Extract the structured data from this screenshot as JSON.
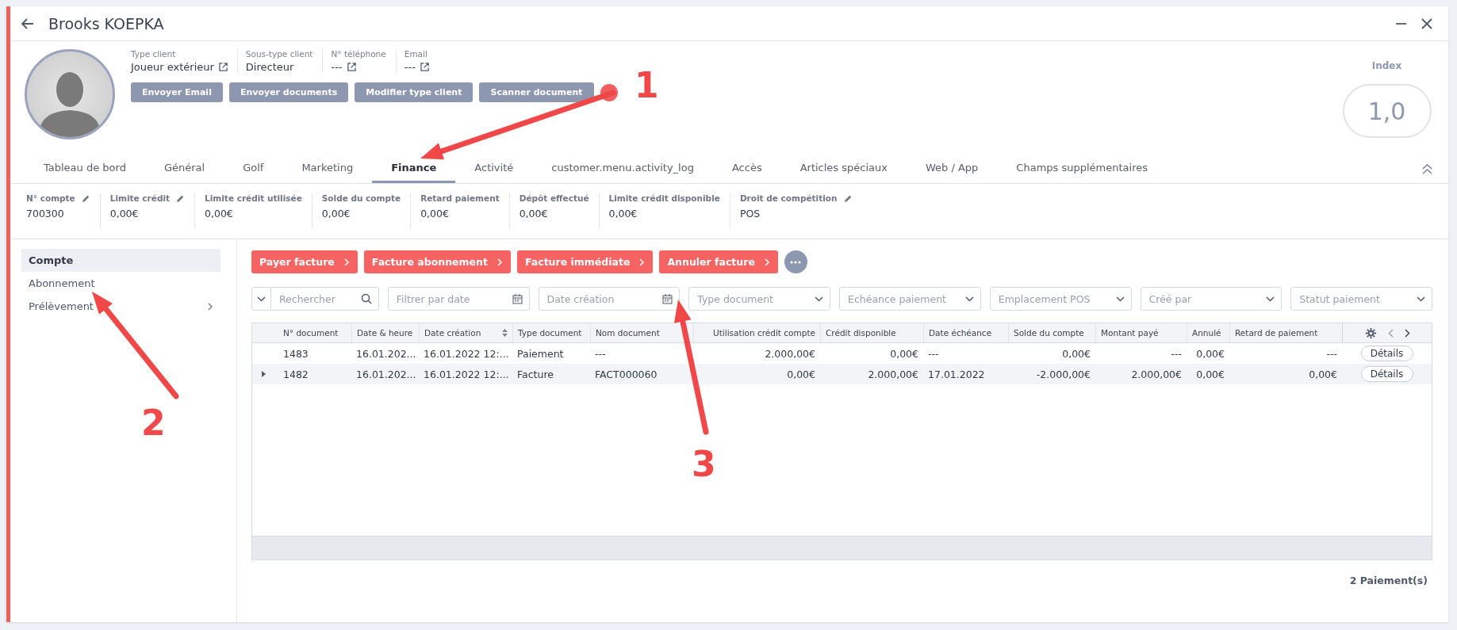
{
  "window": {
    "title": "Brooks KOEPKA"
  },
  "profile": {
    "fields": [
      {
        "label": "Type client",
        "value": "Joueur extérieur",
        "link": true
      },
      {
        "label": "Sous-type client",
        "value": "Directeur",
        "link": false
      },
      {
        "label": "N° téléphone",
        "value": "---",
        "link": true
      },
      {
        "label": "Email",
        "value": "---",
        "link": true
      }
    ],
    "buttons": [
      "Envoyer Email",
      "Envoyer documents",
      "Modifier type client",
      "Scanner document"
    ],
    "index": {
      "label": "Index",
      "value": "1,0"
    }
  },
  "tabs": [
    {
      "label": "Tableau de bord",
      "selected": false
    },
    {
      "label": "Général",
      "selected": false
    },
    {
      "label": "Golf",
      "selected": false
    },
    {
      "label": "Marketing",
      "selected": false
    },
    {
      "label": "Finance",
      "selected": true
    },
    {
      "label": "Activité",
      "selected": false
    },
    {
      "label": "customer.menu.activity_log",
      "selected": false
    },
    {
      "label": "Accès",
      "selected": false
    },
    {
      "label": "Articles spéciaux",
      "selected": false
    },
    {
      "label": "Web / App",
      "selected": false
    },
    {
      "label": "Champs supplémentaires",
      "selected": false
    }
  ],
  "metrics": [
    {
      "label": "N° compte",
      "value": "700300",
      "editable": true
    },
    {
      "label": "Limite crédit",
      "value": "0,00€",
      "editable": true
    },
    {
      "label": "Limite crédit utilisée",
      "value": "0,00€",
      "editable": false
    },
    {
      "label": "Solde du compte",
      "value": "0,00€",
      "editable": false
    },
    {
      "label": "Retard paiement",
      "value": "0,00€",
      "editable": false
    },
    {
      "label": "Dépôt effectué",
      "value": "0,00€",
      "editable": false
    },
    {
      "label": "Limite crédit disponible",
      "value": "0,00€",
      "editable": false
    },
    {
      "label": "Droit de compétition",
      "value": "POS",
      "editable": true
    }
  ],
  "sidebar": {
    "items": [
      {
        "label": "Compte",
        "selected": true,
        "has_children": false
      },
      {
        "label": "Abonnement",
        "selected": false,
        "has_children": false
      },
      {
        "label": "Prélèvement",
        "selected": false,
        "has_children": true
      }
    ]
  },
  "actions": [
    "Payer facture",
    "Facture abonnement",
    "Facture immédiate",
    "Annuler facture"
  ],
  "filters": [
    {
      "kind": "search",
      "placeholder": "Rechercher"
    },
    {
      "kind": "date",
      "placeholder": "Filtrer par date"
    },
    {
      "kind": "date",
      "placeholder": "Date création"
    },
    {
      "kind": "select",
      "placeholder": "Type document"
    },
    {
      "kind": "select",
      "placeholder": "Echéance paiement"
    },
    {
      "kind": "select",
      "placeholder": "Emplacement POS"
    },
    {
      "kind": "select",
      "placeholder": "Créé par"
    },
    {
      "kind": "select",
      "placeholder": "Statut paiement"
    }
  ],
  "table": {
    "columns": [
      {
        "label": "N° document",
        "sortable": false
      },
      {
        "label": "Date & heure",
        "sortable": false
      },
      {
        "label": "Date création",
        "sortable": true
      },
      {
        "label": "Type document",
        "sortable": false
      },
      {
        "label": "Nom document",
        "sortable": false
      },
      {
        "label": "Utilisation crédit compte",
        "sortable": false
      },
      {
        "label": "Crédit disponible",
        "sortable": false
      },
      {
        "label": "Date échéance",
        "sortable": false
      },
      {
        "label": "Solde du compte",
        "sortable": false
      },
      {
        "label": "Montant payé",
        "sortable": false
      },
      {
        "label": "Annulé",
        "sortable": false
      },
      {
        "label": "Retard de paiement",
        "sortable": false
      }
    ],
    "rows": [
      {
        "expandable": false,
        "cells": [
          "1483",
          "16.01.202...",
          "16.01.2022 12:...",
          "Paiement",
          "---",
          "2.000,00€",
          "0,00€",
          "---",
          "0,00€",
          "---",
          "0,00€",
          "---"
        ],
        "action": "Détails"
      },
      {
        "expandable": true,
        "cells": [
          "1482",
          "16.01.202...",
          "16.01.2022 12:...",
          "Facture",
          "FACT000060",
          "0,00€",
          "2.000,00€",
          "17.01.2022",
          "-2.000,00€",
          "2.000,00€",
          "0,00€",
          "0,00€"
        ],
        "action": "Détails"
      }
    ]
  },
  "footer": "2 Paiement(s)",
  "annotations": [
    "1",
    "2",
    "3"
  ]
}
